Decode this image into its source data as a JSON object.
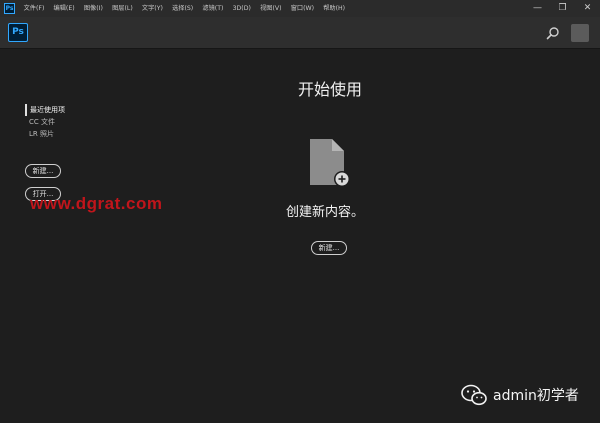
{
  "menubar": {
    "app_icon": "Ps",
    "items": [
      "文件(F)",
      "编辑(E)",
      "图像(I)",
      "图层(L)",
      "文字(Y)",
      "选择(S)",
      "滤镜(T)",
      "3D(D)",
      "视图(V)",
      "窗口(W)",
      "帮助(H)"
    ],
    "controls": [
      "—",
      "❐",
      "✕"
    ]
  },
  "appbar": {
    "logo": "Ps",
    "search_icon": "search-icon"
  },
  "sidebar": {
    "items": [
      "最近使用项",
      "CC 文件",
      "LR 照片"
    ],
    "new_button": "新建...",
    "open_button": "打开..."
  },
  "main": {
    "title": "开始使用",
    "doc_icon": "new-document-icon",
    "create_text": "创建新内容。",
    "new_button": "新建..."
  },
  "watermarks": {
    "site": "www.dgrat.com",
    "wechat_label": "admin初学者"
  },
  "colors": {
    "background": "#1e1e1e",
    "ps_blue": "#31a8ff",
    "watermark_red": "#c0151b"
  }
}
